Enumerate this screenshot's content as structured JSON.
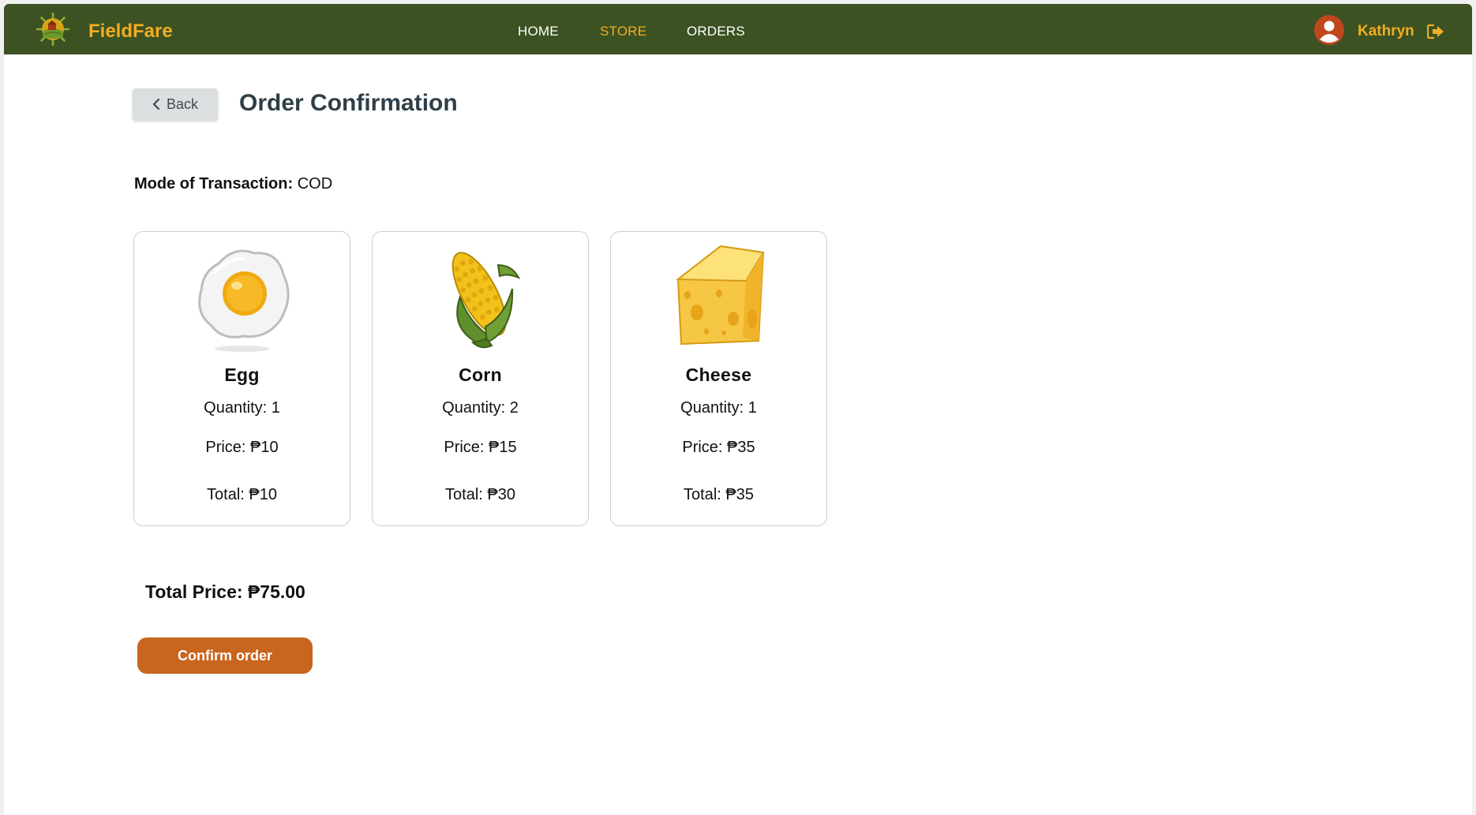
{
  "navbar": {
    "brand": "FieldFare",
    "links": [
      {
        "label": "HOME",
        "active": false
      },
      {
        "label": "STORE",
        "active": true
      },
      {
        "label": "ORDERS",
        "active": false
      }
    ],
    "user_name": "Kathryn",
    "logo_icon": "farm-logo-icon",
    "avatar_icon": "user-avatar-icon",
    "logout_icon": "logout-icon"
  },
  "header": {
    "back_label": "Back",
    "title": "Order Confirmation"
  },
  "transaction": {
    "label": "Mode of Transaction:",
    "value": "COD"
  },
  "items": [
    {
      "name": "Egg",
      "quantity": "Quantity: 1",
      "price": "Price: ₱10",
      "total": "Total: ₱10",
      "icon": "fried-egg-icon"
    },
    {
      "name": "Corn",
      "quantity": "Quantity: 2",
      "price": "Price: ₱15",
      "total": "Total: ₱30",
      "icon": "corn-icon"
    },
    {
      "name": "Cheese",
      "quantity": "Quantity: 1",
      "price": "Price: ₱35",
      "total": "Total: ₱35",
      "icon": "cheese-icon"
    }
  ],
  "summary": {
    "total_price": "Total Price: ₱75.00",
    "confirm_label": "Confirm order"
  },
  "colors": {
    "navbar_bg": "#3c5222",
    "accent": "#f2ad21",
    "confirm_bg": "#c8651f",
    "avatar_bg": "#c0481c"
  }
}
